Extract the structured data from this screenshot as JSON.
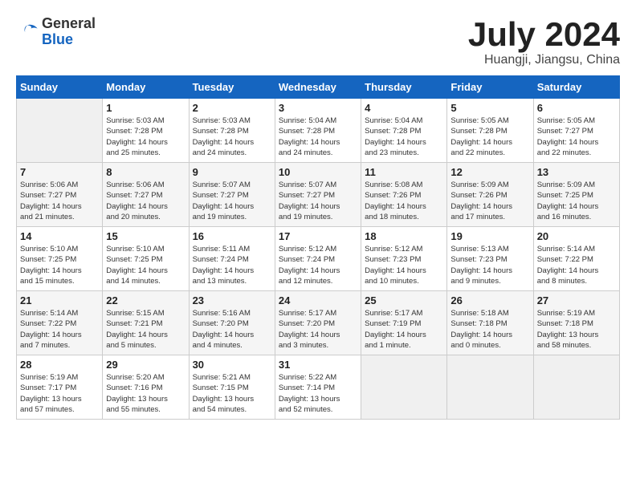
{
  "logo": {
    "general": "General",
    "blue": "Blue"
  },
  "title": "July 2024",
  "subtitle": "Huangji, Jiangsu, China",
  "days_header": [
    "Sunday",
    "Monday",
    "Tuesday",
    "Wednesday",
    "Thursday",
    "Friday",
    "Saturday"
  ],
  "weeks": [
    [
      {
        "day": "",
        "info": ""
      },
      {
        "day": "1",
        "info": "Sunrise: 5:03 AM\nSunset: 7:28 PM\nDaylight: 14 hours\nand 25 minutes."
      },
      {
        "day": "2",
        "info": "Sunrise: 5:03 AM\nSunset: 7:28 PM\nDaylight: 14 hours\nand 24 minutes."
      },
      {
        "day": "3",
        "info": "Sunrise: 5:04 AM\nSunset: 7:28 PM\nDaylight: 14 hours\nand 24 minutes."
      },
      {
        "day": "4",
        "info": "Sunrise: 5:04 AM\nSunset: 7:28 PM\nDaylight: 14 hours\nand 23 minutes."
      },
      {
        "day": "5",
        "info": "Sunrise: 5:05 AM\nSunset: 7:28 PM\nDaylight: 14 hours\nand 22 minutes."
      },
      {
        "day": "6",
        "info": "Sunrise: 5:05 AM\nSunset: 7:27 PM\nDaylight: 14 hours\nand 22 minutes."
      }
    ],
    [
      {
        "day": "7",
        "info": "Sunrise: 5:06 AM\nSunset: 7:27 PM\nDaylight: 14 hours\nand 21 minutes."
      },
      {
        "day": "8",
        "info": "Sunrise: 5:06 AM\nSunset: 7:27 PM\nDaylight: 14 hours\nand 20 minutes."
      },
      {
        "day": "9",
        "info": "Sunrise: 5:07 AM\nSunset: 7:27 PM\nDaylight: 14 hours\nand 19 minutes."
      },
      {
        "day": "10",
        "info": "Sunrise: 5:07 AM\nSunset: 7:27 PM\nDaylight: 14 hours\nand 19 minutes."
      },
      {
        "day": "11",
        "info": "Sunrise: 5:08 AM\nSunset: 7:26 PM\nDaylight: 14 hours\nand 18 minutes."
      },
      {
        "day": "12",
        "info": "Sunrise: 5:09 AM\nSunset: 7:26 PM\nDaylight: 14 hours\nand 17 minutes."
      },
      {
        "day": "13",
        "info": "Sunrise: 5:09 AM\nSunset: 7:25 PM\nDaylight: 14 hours\nand 16 minutes."
      }
    ],
    [
      {
        "day": "14",
        "info": "Sunrise: 5:10 AM\nSunset: 7:25 PM\nDaylight: 14 hours\nand 15 minutes."
      },
      {
        "day": "15",
        "info": "Sunrise: 5:10 AM\nSunset: 7:25 PM\nDaylight: 14 hours\nand 14 minutes."
      },
      {
        "day": "16",
        "info": "Sunrise: 5:11 AM\nSunset: 7:24 PM\nDaylight: 14 hours\nand 13 minutes."
      },
      {
        "day": "17",
        "info": "Sunrise: 5:12 AM\nSunset: 7:24 PM\nDaylight: 14 hours\nand 12 minutes."
      },
      {
        "day": "18",
        "info": "Sunrise: 5:12 AM\nSunset: 7:23 PM\nDaylight: 14 hours\nand 10 minutes."
      },
      {
        "day": "19",
        "info": "Sunrise: 5:13 AM\nSunset: 7:23 PM\nDaylight: 14 hours\nand 9 minutes."
      },
      {
        "day": "20",
        "info": "Sunrise: 5:14 AM\nSunset: 7:22 PM\nDaylight: 14 hours\nand 8 minutes."
      }
    ],
    [
      {
        "day": "21",
        "info": "Sunrise: 5:14 AM\nSunset: 7:22 PM\nDaylight: 14 hours\nand 7 minutes."
      },
      {
        "day": "22",
        "info": "Sunrise: 5:15 AM\nSunset: 7:21 PM\nDaylight: 14 hours\nand 5 minutes."
      },
      {
        "day": "23",
        "info": "Sunrise: 5:16 AM\nSunset: 7:20 PM\nDaylight: 14 hours\nand 4 minutes."
      },
      {
        "day": "24",
        "info": "Sunrise: 5:17 AM\nSunset: 7:20 PM\nDaylight: 14 hours\nand 3 minutes."
      },
      {
        "day": "25",
        "info": "Sunrise: 5:17 AM\nSunset: 7:19 PM\nDaylight: 14 hours\nand 1 minute."
      },
      {
        "day": "26",
        "info": "Sunrise: 5:18 AM\nSunset: 7:18 PM\nDaylight: 14 hours\nand 0 minutes."
      },
      {
        "day": "27",
        "info": "Sunrise: 5:19 AM\nSunset: 7:18 PM\nDaylight: 13 hours\nand 58 minutes."
      }
    ],
    [
      {
        "day": "28",
        "info": "Sunrise: 5:19 AM\nSunset: 7:17 PM\nDaylight: 13 hours\nand 57 minutes."
      },
      {
        "day": "29",
        "info": "Sunrise: 5:20 AM\nSunset: 7:16 PM\nDaylight: 13 hours\nand 55 minutes."
      },
      {
        "day": "30",
        "info": "Sunrise: 5:21 AM\nSunset: 7:15 PM\nDaylight: 13 hours\nand 54 minutes."
      },
      {
        "day": "31",
        "info": "Sunrise: 5:22 AM\nSunset: 7:14 PM\nDaylight: 13 hours\nand 52 minutes."
      },
      {
        "day": "",
        "info": ""
      },
      {
        "day": "",
        "info": ""
      },
      {
        "day": "",
        "info": ""
      }
    ]
  ]
}
